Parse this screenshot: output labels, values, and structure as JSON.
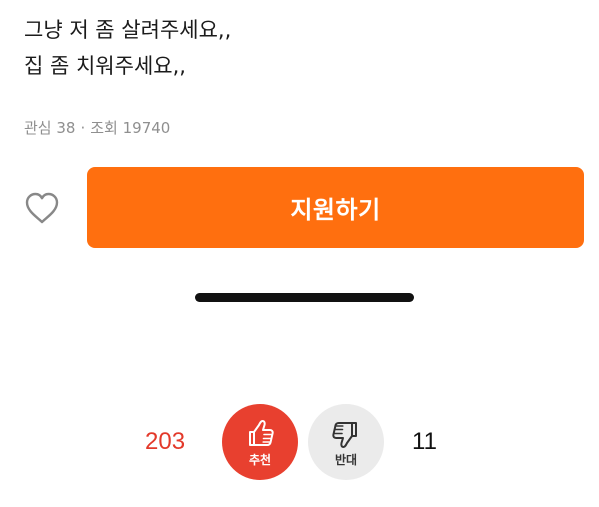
{
  "post": {
    "lines": [
      "그냥 저 좀 살려주세요,,",
      "집 좀 치워주세요,,"
    ],
    "stats": {
      "interest_label": "관심 38",
      "separator": "·",
      "views_label": "조회 19740"
    }
  },
  "actions": {
    "heart_icon": "heart-outline",
    "apply_label": "지원하기",
    "apply_color": "#ff6f0f"
  },
  "votes": {
    "up_count": "203",
    "up_label": "추천",
    "up_color": "#e8402f",
    "down_count": "11",
    "down_label": "반대",
    "down_color": "#ebebeb"
  }
}
